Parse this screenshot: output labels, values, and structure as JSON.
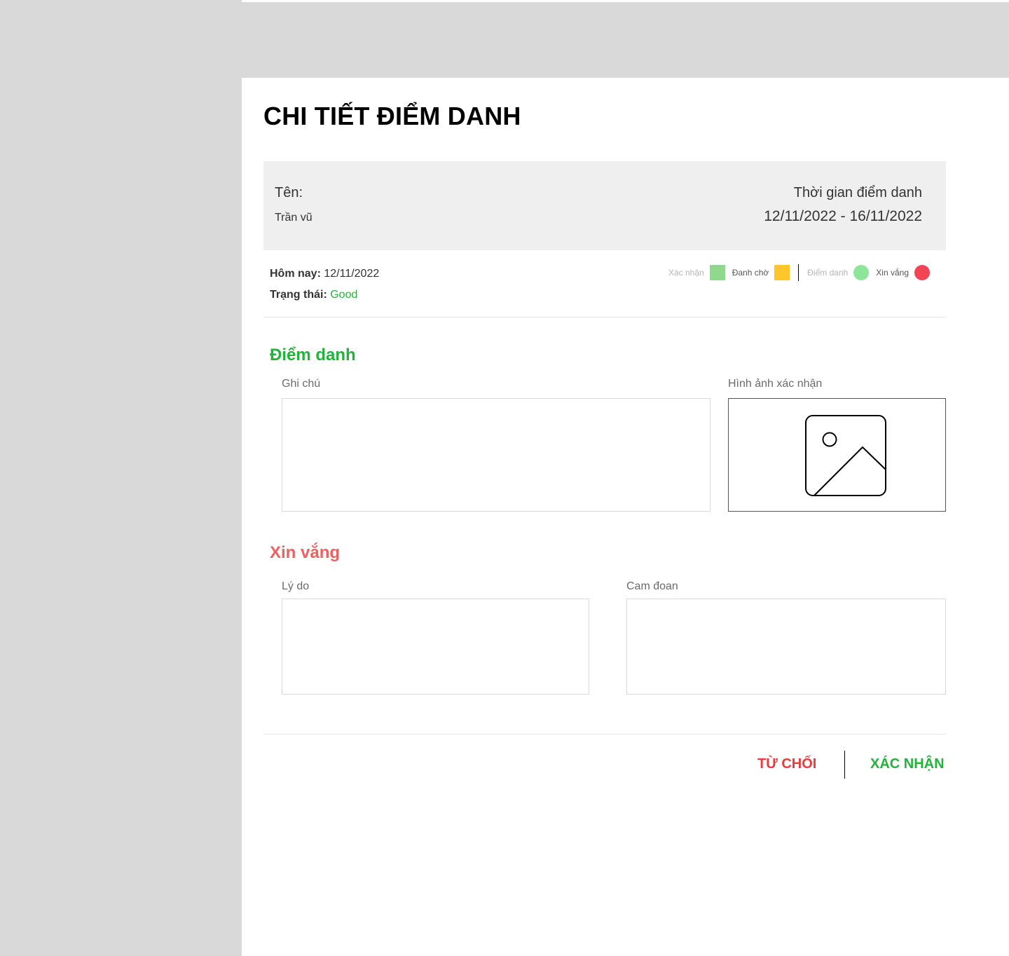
{
  "page": {
    "title": "CHI TIẾT ĐIỂM DANH"
  },
  "info": {
    "name_label": "Tên:",
    "name_value": "Trần vũ",
    "time_label": "Thời gian điểm danh",
    "time_value": "12/11/2022 - 16/11/2022"
  },
  "summary": {
    "today_label": "Hôm nay:",
    "today_value": "12/11/2022",
    "status_label": "Trạng thái:",
    "status_value": "Good"
  },
  "legend": {
    "items": [
      {
        "label": "Xác nhận",
        "shape": "square",
        "color": "#8fd98f"
      },
      {
        "label": "Đanh chờ",
        "shape": "square",
        "color": "#ffc629"
      },
      {
        "label": "Điểm danh",
        "shape": "circle",
        "color": "#8ee59a"
      },
      {
        "label": "Xin vắng",
        "shape": "circle",
        "color": "#f24452"
      }
    ]
  },
  "attendance": {
    "title": "Điểm danh",
    "note_label": "Ghi chú",
    "image_label": "Hình ảnh xác nhận",
    "image_icon": "image-placeholder-icon"
  },
  "leave": {
    "title": "Xin vắng",
    "reason_label": "Lý do",
    "pledge_label": "Cam đoan"
  },
  "actions": {
    "reject_label": "TỪ CHỐI",
    "confirm_label": "XÁC NHẬN"
  },
  "colors": {
    "accent_green": "#22b33a",
    "accent_red": "#ee3a3a",
    "leave_red": "#f06060"
  }
}
